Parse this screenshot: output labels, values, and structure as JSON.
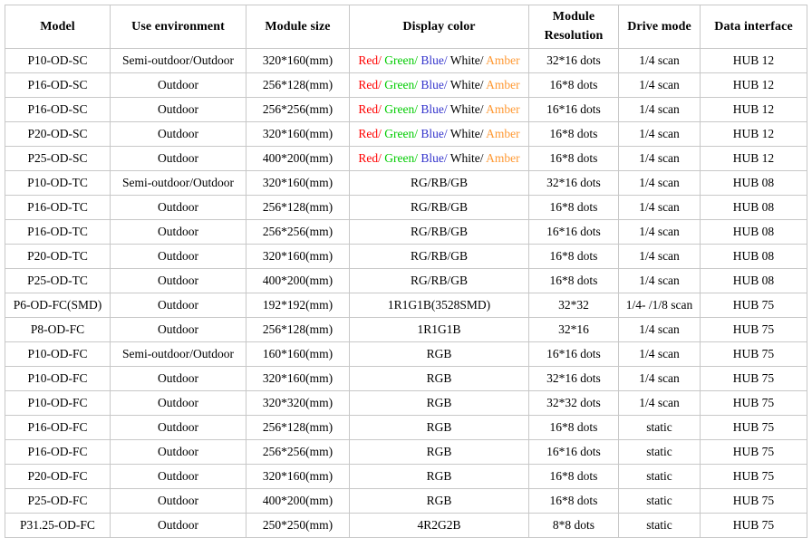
{
  "table": {
    "name": "LED module specification table",
    "columns": [
      {
        "key": "model",
        "label": "Model"
      },
      {
        "key": "env",
        "label": "Use environment"
      },
      {
        "key": "size",
        "label": "Module size"
      },
      {
        "key": "color",
        "label": "Display color"
      },
      {
        "key": "res",
        "label": "Module Resolution",
        "label_line1": "Module",
        "label_line2": "Resolution"
      },
      {
        "key": "drive",
        "label": "Drive mode"
      },
      {
        "key": "iface",
        "label": "Data interface"
      }
    ],
    "color_palette": {
      "red": "#ff0000",
      "green": "#00cc00",
      "blue": "#3333cc",
      "white": "#000000",
      "amber": "#ff9933",
      "border": "#c8c8c8",
      "text": "#000000",
      "background": "#ffffff"
    },
    "multicolor_cell": {
      "parts": [
        {
          "text": "Red/ ",
          "tone": "red"
        },
        {
          "text": "Green/ ",
          "tone": "green"
        },
        {
          "text": "Blue/ ",
          "tone": "blue"
        },
        {
          "text": "White/ ",
          "tone": "white"
        },
        {
          "text": "Amber",
          "tone": "amber"
        }
      ]
    },
    "rows": [
      {
        "model": "P10-OD-SC",
        "env": "Semi-outdoor/Outdoor",
        "size": "320*160(mm)",
        "color": "Red/ Green/ Blue/ White/ Amber",
        "color_multicolor": true,
        "res": "32*16 dots",
        "drive": "1/4 scan",
        "iface": "HUB 12"
      },
      {
        "model": "P16-OD-SC",
        "env": "Outdoor",
        "size": "256*128(mm)",
        "color": "Red/ Green/ Blue/ White/ Amber",
        "color_multicolor": true,
        "res": "16*8 dots",
        "drive": "1/4 scan",
        "iface": "HUB 12"
      },
      {
        "model": "P16-OD-SC",
        "env": "Outdoor",
        "size": "256*256(mm)",
        "color": "Red/ Green/ Blue/ White/ Amber",
        "color_multicolor": true,
        "res": "16*16 dots",
        "drive": "1/4 scan",
        "iface": "HUB 12"
      },
      {
        "model": "P20-OD-SC",
        "env": "Outdoor",
        "size": "320*160(mm)",
        "color": "Red/ Green/ Blue/ White/ Amber",
        "color_multicolor": true,
        "res": "16*8 dots",
        "drive": "1/4 scan",
        "iface": "HUB 12"
      },
      {
        "model": "P25-OD-SC",
        "env": "Outdoor",
        "size": "400*200(mm)",
        "color": "Red/ Green/ Blue/ White/ Amber",
        "color_multicolor": true,
        "res": "16*8 dots",
        "drive": "1/4 scan",
        "iface": "HUB 12"
      },
      {
        "model": "P10-OD-TC",
        "env": "Semi-outdoor/Outdoor",
        "size": "320*160(mm)",
        "color": "RG/RB/GB",
        "color_multicolor": false,
        "res": "32*16 dots",
        "drive": "1/4 scan",
        "iface": "HUB 08"
      },
      {
        "model": "P16-OD-TC",
        "env": "Outdoor",
        "size": "256*128(mm)",
        "color": "RG/RB/GB",
        "color_multicolor": false,
        "res": "16*8 dots",
        "drive": "1/4 scan",
        "iface": "HUB 08"
      },
      {
        "model": "P16-OD-TC",
        "env": "Outdoor",
        "size": "256*256(mm)",
        "color": "RG/RB/GB",
        "color_multicolor": false,
        "res": "16*16 dots",
        "drive": "1/4 scan",
        "iface": "HUB 08"
      },
      {
        "model": "P20-OD-TC",
        "env": "Outdoor",
        "size": "320*160(mm)",
        "color": "RG/RB/GB",
        "color_multicolor": false,
        "res": "16*8 dots",
        "drive": "1/4 scan",
        "iface": "HUB 08"
      },
      {
        "model": "P25-OD-TC",
        "env": "Outdoor",
        "size": "400*200(mm)",
        "color": "RG/RB/GB",
        "color_multicolor": false,
        "res": "16*8 dots",
        "drive": "1/4 scan",
        "iface": "HUB 08"
      },
      {
        "model": "P6-OD-FC(SMD)",
        "env": "Outdoor",
        "size": "192*192(mm)",
        "color": "1R1G1B(3528SMD)",
        "color_multicolor": false,
        "res": "32*32",
        "drive": "1/4- /1/8 scan",
        "iface": "HUB 75"
      },
      {
        "model": "P8-OD-FC",
        "env": "Outdoor",
        "size": "256*128(mm)",
        "color": "1R1G1B",
        "color_multicolor": false,
        "res": "32*16",
        "drive": "1/4 scan",
        "iface": "HUB 75"
      },
      {
        "model": "P10-OD-FC",
        "env": "Semi-outdoor/Outdoor",
        "size": "160*160(mm)",
        "color": "RGB",
        "color_multicolor": false,
        "res": "16*16 dots",
        "drive": "1/4 scan",
        "iface": "HUB 75"
      },
      {
        "model": "P10-OD-FC",
        "env": "Outdoor",
        "size": "320*160(mm)",
        "color": "RGB",
        "color_multicolor": false,
        "res": "32*16 dots",
        "drive": "1/4 scan",
        "iface": "HUB 75"
      },
      {
        "model": "P10-OD-FC",
        "env": "Outdoor",
        "size": "320*320(mm)",
        "color": "RGB",
        "color_multicolor": false,
        "res": "32*32 dots",
        "drive": "1/4 scan",
        "iface": "HUB 75"
      },
      {
        "model": "P16-OD-FC",
        "env": "Outdoor",
        "size": "256*128(mm)",
        "color": "RGB",
        "color_multicolor": false,
        "res": "16*8 dots",
        "drive": "static",
        "iface": "HUB 75"
      },
      {
        "model": "P16-OD-FC",
        "env": "Outdoor",
        "size": "256*256(mm)",
        "color": "RGB",
        "color_multicolor": false,
        "res": "16*16 dots",
        "drive": "static",
        "iface": "HUB 75"
      },
      {
        "model": "P20-OD-FC",
        "env": "Outdoor",
        "size": "320*160(mm)",
        "color": "RGB",
        "color_multicolor": false,
        "res": "16*8 dots",
        "drive": "static",
        "iface": "HUB 75"
      },
      {
        "model": "P25-OD-FC",
        "env": "Outdoor",
        "size": "400*200(mm)",
        "color": "RGB",
        "color_multicolor": false,
        "res": "16*8 dots",
        "drive": "static",
        "iface": "HUB 75"
      },
      {
        "model": "P31.25-OD-FC",
        "env": "Outdoor",
        "size": "250*250(mm)",
        "color": "4R2G2B",
        "color_multicolor": false,
        "res": "8*8 dots",
        "drive": "static",
        "iface": "HUB 75"
      }
    ]
  }
}
